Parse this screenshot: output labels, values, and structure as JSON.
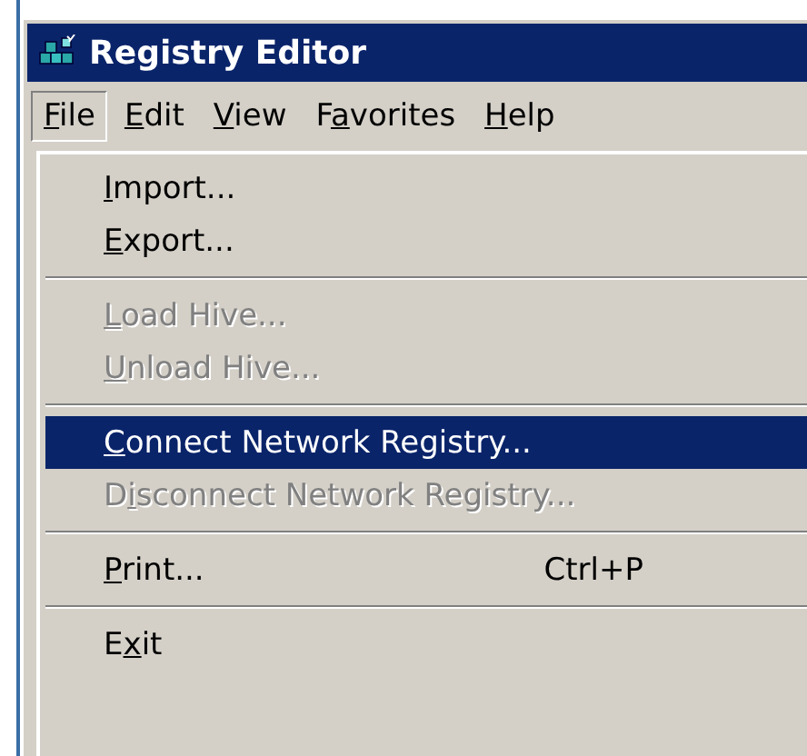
{
  "window": {
    "title": "Registry Editor"
  },
  "menu_bar": [
    {
      "key": "F",
      "rest": "ile",
      "selected": true
    },
    {
      "key": "E",
      "rest": "dit",
      "selected": false
    },
    {
      "key": "V",
      "rest": "iew",
      "selected": false
    },
    {
      "lead": "F",
      "key": "a",
      "rest": "vorites",
      "selected": false
    },
    {
      "key": "H",
      "rest": "elp",
      "selected": false
    }
  ],
  "file_menu": [
    {
      "kind": "item",
      "key": "I",
      "rest": "mport...",
      "disabled": false,
      "selected": false
    },
    {
      "kind": "item",
      "key": "E",
      "rest": "xport...",
      "disabled": false,
      "selected": false
    },
    {
      "kind": "separator"
    },
    {
      "kind": "item",
      "key": "L",
      "rest": "oad Hive...",
      "disabled": true,
      "selected": false
    },
    {
      "kind": "item",
      "key": "U",
      "rest": "nload Hive...",
      "disabled": true,
      "selected": false
    },
    {
      "kind": "separator"
    },
    {
      "kind": "item",
      "key": "C",
      "rest": "onnect Network Registry...",
      "disabled": false,
      "selected": true
    },
    {
      "kind": "item",
      "lead": "D",
      "key": "i",
      "rest": "sconnect Network Registry...",
      "disabled": true,
      "selected": false
    },
    {
      "kind": "separator"
    },
    {
      "kind": "item",
      "key": "P",
      "rest": "rint...",
      "shortcut": "Ctrl+P",
      "disabled": false,
      "selected": false
    },
    {
      "kind": "separator"
    },
    {
      "kind": "item",
      "lead": "E",
      "key": "x",
      "rest": "it",
      "disabled": false,
      "selected": false
    }
  ]
}
